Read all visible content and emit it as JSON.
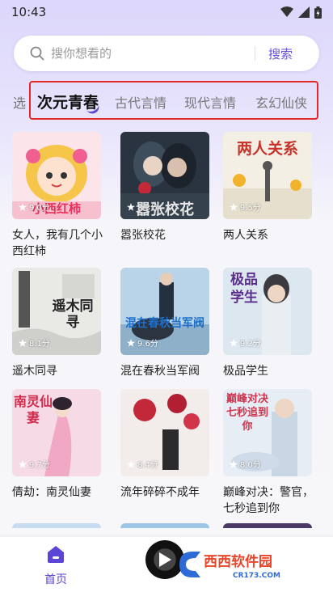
{
  "status_bar": {
    "time": "10:43"
  },
  "search": {
    "placeholder": "搜你想看的",
    "button_label": "搜索"
  },
  "tabs": [
    {
      "label": "选",
      "active": false
    },
    {
      "label": "次元青春",
      "active": true
    },
    {
      "label": "古代言情",
      "active": false
    },
    {
      "label": "现代言情",
      "active": false
    },
    {
      "label": "玄幻仙侠",
      "active": false
    }
  ],
  "books": [
    {
      "title": "女人，我有几个小西红柿",
      "rating": "9.0分",
      "cover_text": "小西红柿"
    },
    {
      "title": "嚣张校花",
      "rating": "8.3分",
      "cover_text": "嚣张校花"
    },
    {
      "title": "两人关系",
      "rating": "9.5分",
      "cover_text": "两人关系"
    },
    {
      "title": "遥木同寻",
      "rating": "8.1分",
      "cover_text": "遥木同寻"
    },
    {
      "title": "混在春秋当军阀",
      "rating": "9.6分",
      "cover_text": "混在春秋当军阀"
    },
    {
      "title": "极品学生",
      "rating": "9.2分",
      "cover_text": "极品学生"
    },
    {
      "title": "倩劫：南灵仙妻",
      "rating": "9.7分",
      "cover_text": "南灵仙妻"
    },
    {
      "title": "流年碎碎不成年",
      "rating": "8.4分",
      "cover_text": ""
    },
    {
      "title": "巅峰对决：警官，七秒追到你",
      "rating": "8.0分",
      "cover_text": "巅峰对决 七秒追到你"
    }
  ],
  "bottom_nav": {
    "home_label": "首页"
  },
  "watermark": {
    "brand": "西西软件园",
    "domain": "CR173.COM"
  },
  "colors": {
    "accent": "#5b45d6",
    "highlight": "#e02a2a"
  }
}
